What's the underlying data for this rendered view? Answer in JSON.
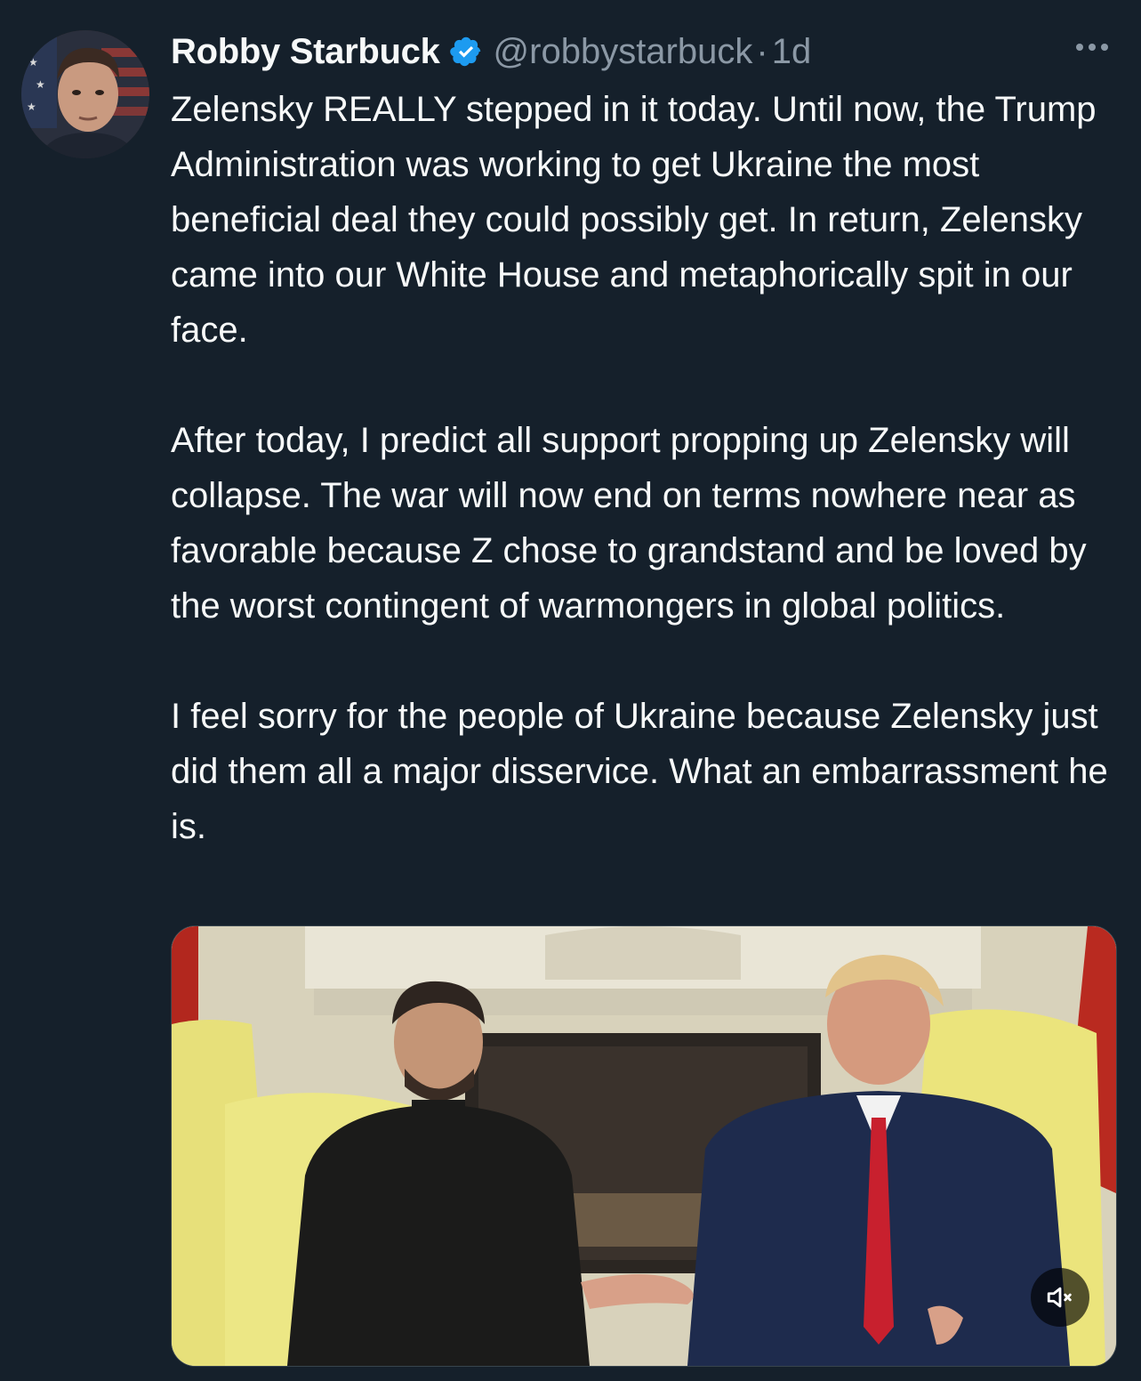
{
  "tweet": {
    "author_name": "Robby Starbuck",
    "handle": "@robbystarbuck",
    "separator": "·",
    "time": "1d",
    "paragraphs": [
      "Zelensky REALLY stepped in it today. Until now, the Trump Administration was working to get Ukraine the most beneficial deal they could possibly get. In return, Zelensky came into our White House and metaphorically spit in our face.",
      "After today, I predict all support propping up Zelensky will collapse. The war will now end on terms nowhere near as favorable because Z chose to grandstand and be loved by the worst contingent of warmongers in global politics.",
      "I feel sorry for the people of Ukraine because Zelensky just did them all a major disservice. What an embarrassment he is."
    ]
  },
  "icons": {
    "verified": "verified-badge-icon",
    "more": "more-horizontal-icon",
    "mute": "volume-muted-icon"
  },
  "colors": {
    "background": "#15202b",
    "text": "#f7f9f9",
    "secondary": "#8b98a5",
    "verified": "#1d9bf0"
  }
}
